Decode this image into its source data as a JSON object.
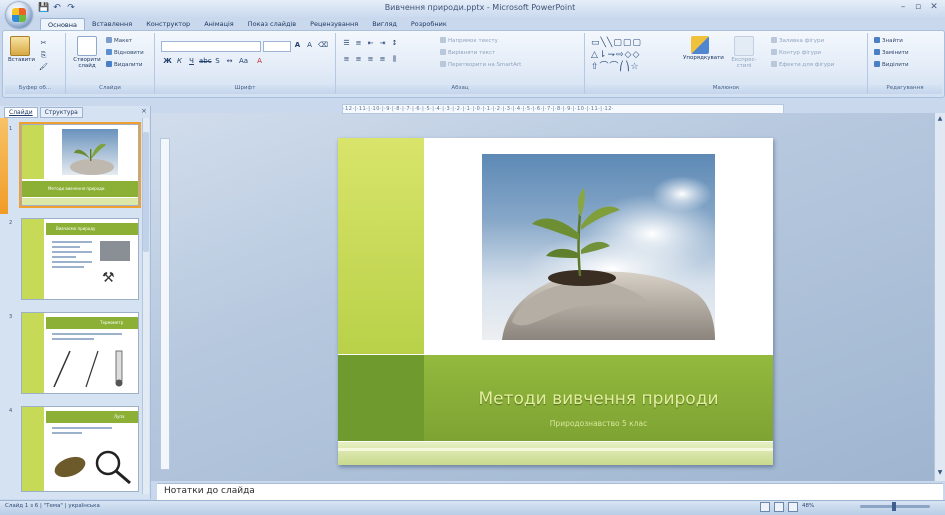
{
  "window": {
    "title": "Вивчення природи.pptx - Microsoft PowerPoint",
    "controls": [
      "–",
      "▫",
      "✕"
    ]
  },
  "qat": {
    "save": "💾",
    "undo": "↶",
    "redo": "↷"
  },
  "tabs": [
    "Основна",
    "Вставлення",
    "Конструктор",
    "Анімація",
    "Показ слайдів",
    "Рецензування",
    "Вигляд",
    "Розробник"
  ],
  "ribbon": {
    "clipboard": {
      "paste": "Вставити",
      "cut": "Вирізати",
      "copy": "Копіювати",
      "format": "Формат",
      "label": "Буфер об..."
    },
    "slides": {
      "new_slide": "Створити слайд",
      "layout": "Макет",
      "reset": "Відновити",
      "delete": "Видалити",
      "label": "Слайди"
    },
    "font": {
      "label": "Шрифт"
    },
    "paragraph": {
      "text_direction": "Напрямок тексту",
      "align_text": "Вирівняти текст",
      "smartart": "Перетворити на SmartArt",
      "label": "Абзац"
    },
    "drawing": {
      "arrange": "Упорядкувати",
      "quick_styles": "Експрес-стилі",
      "fill": "Заливка фігури",
      "outline": "Контур фігури",
      "effects": "Ефекти для фігури",
      "label": "Малюнок"
    },
    "editing": {
      "find": "Знайти",
      "replace": "Замінити",
      "select": "Виділити",
      "label": "Редагування"
    }
  },
  "ruler": "·12·|·11·|·10·|·9·|·8·|·7·|·6·|·5·|·4·|·3·|·2·|·1·|·0·|·1·|·2·|·3·|·4·|·5·|·6·|·7·|·8·|·9·|·10·|·11·|·12·",
  "left_pane": {
    "tabs": [
      "Слайди",
      "Структура"
    ],
    "close": "×",
    "thumbnails": [
      {
        "num": "1",
        "title": "Методи вивчення природи"
      },
      {
        "num": "2",
        "title": "Вивчаємо природу"
      },
      {
        "num": "3",
        "title": "Термометр"
      },
      {
        "num": "4",
        "title": "Лупа"
      }
    ]
  },
  "slide": {
    "title": "Методи вивчення природи",
    "subtitle": "Природознавство 5 клас"
  },
  "notes": {
    "placeholder": "Нотатки до слайда"
  },
  "status": {
    "slide_info": "Слайд 1 з 6",
    "theme": "\"Тема\"",
    "language": "українська",
    "zoom": "48%"
  },
  "colors": {
    "lime": "#c7da58",
    "green_band": "#8bb035",
    "accent": "#f19d27"
  }
}
